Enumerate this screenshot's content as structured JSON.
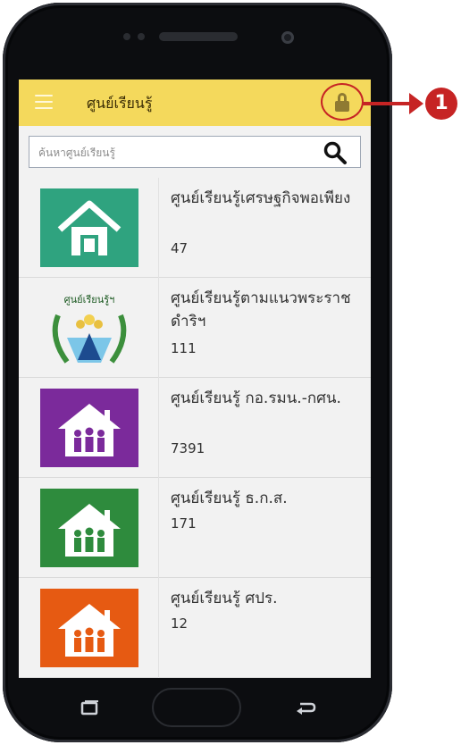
{
  "appbar": {
    "title": "ศูนย์เรียนรู้"
  },
  "search": {
    "placeholder": "ค้นหาศูนย์เรียนรู้",
    "value": ""
  },
  "list": {
    "items": [
      {
        "name": "ศูนย์เรียนรู้เศรษฐกิจพอเพียง",
        "count": "47",
        "icon": "sufficiency-economy-house-logo",
        "color": "#2fa37f"
      },
      {
        "name": "ศูนย์เรียนรู้ตามแนวพระราชดำริฯ",
        "count": "111",
        "icon": "royal-initiative-emblem",
        "color": "#ffffff",
        "emblem_text": "ศูนย์เรียนรู้ฯ"
      },
      {
        "name": "ศูนย์เรียนรู้ กอ.รมน.-กศน.",
        "count": "7391",
        "icon": "family-house-icon",
        "color": "#7b2a9b"
      },
      {
        "name": "ศูนย์เรียนรู้ ธ.ก.ส.",
        "count": "171",
        "icon": "family-house-icon",
        "color": "#2e8b3d"
      },
      {
        "name": "ศูนย์เรียนรู้ ศปร.",
        "count": "12",
        "icon": "family-house-icon",
        "color": "#e65a12"
      }
    ]
  },
  "callout": {
    "number": "1",
    "color": "#c62424"
  },
  "theme": {
    "appbar": "#f4d95c",
    "lock": "#8f7a32"
  }
}
